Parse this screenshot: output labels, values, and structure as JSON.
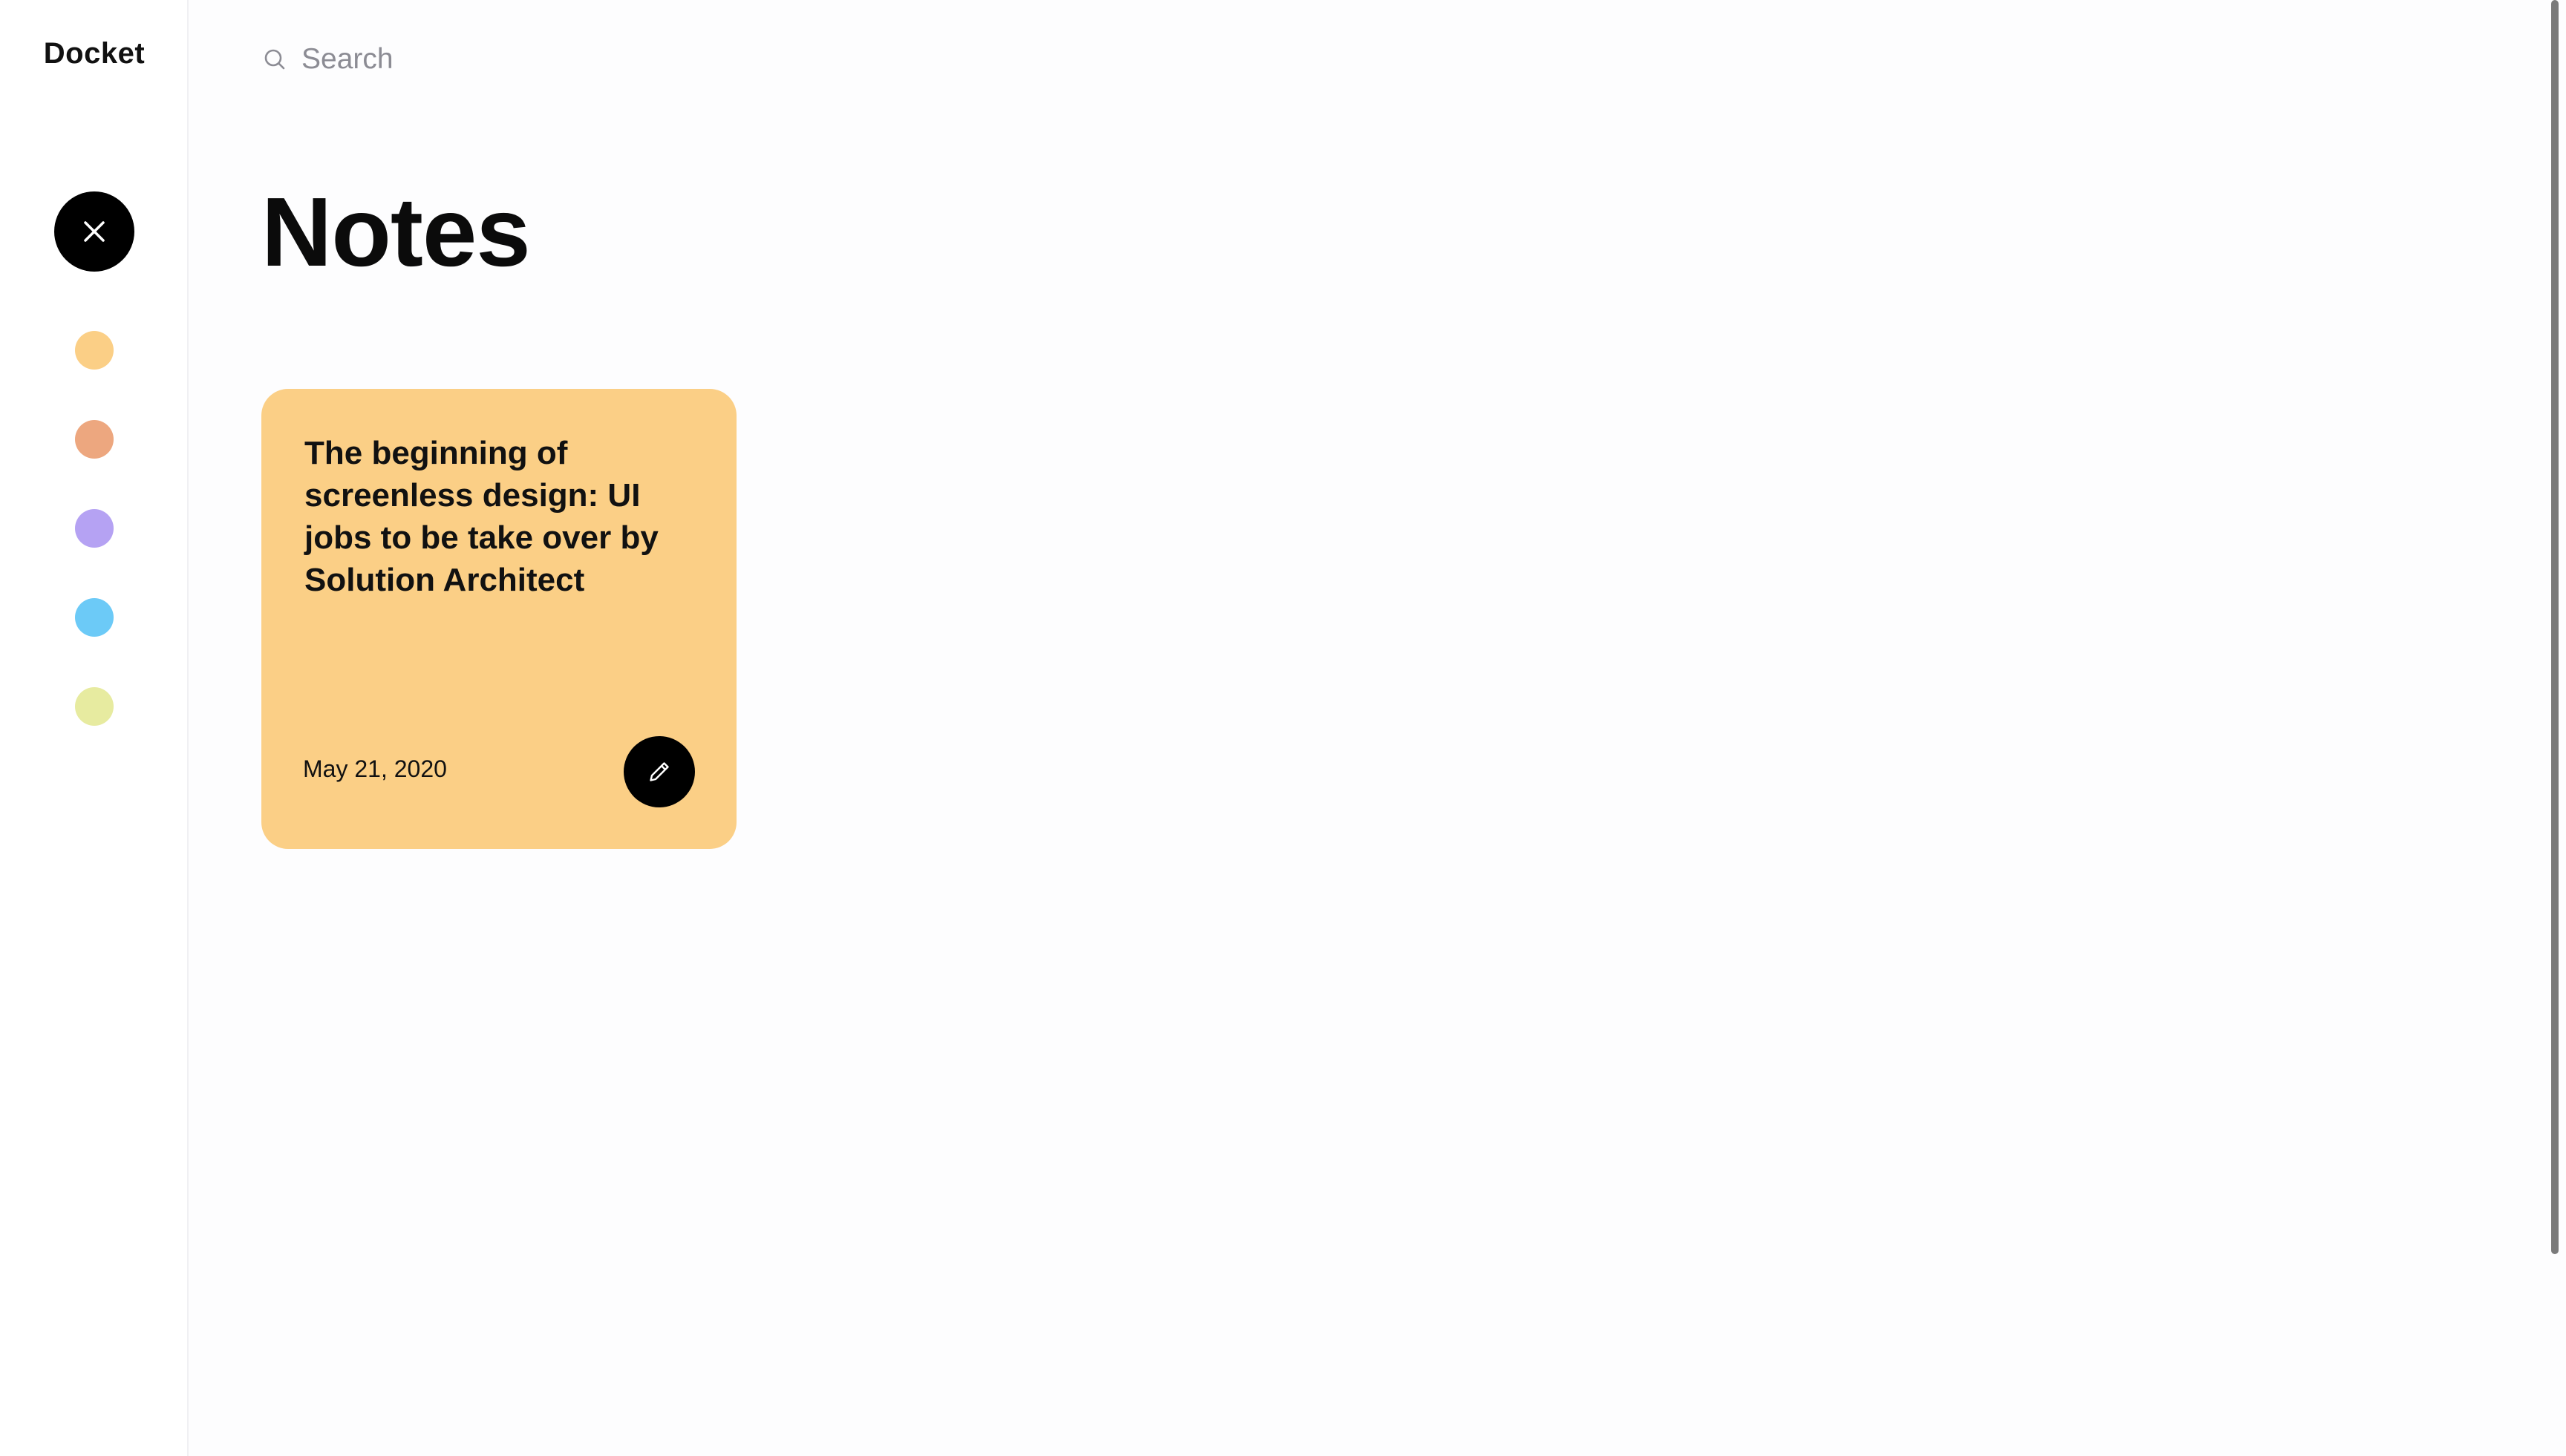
{
  "app": {
    "name": "Docket"
  },
  "sidebar": {
    "close_icon": "close-icon",
    "color_swatches": [
      {
        "name": "yellow",
        "color": "#fbcf86"
      },
      {
        "name": "orange",
        "color": "#eda77f"
      },
      {
        "name": "purple",
        "color": "#b5a2f3"
      },
      {
        "name": "blue",
        "color": "#6ccaf7"
      },
      {
        "name": "lime",
        "color": "#e7eba0"
      }
    ]
  },
  "search": {
    "icon": "search-icon",
    "placeholder": "Search",
    "value": ""
  },
  "main": {
    "title": "Notes",
    "notes": [
      {
        "text": "The beginning of screenless design: UI jobs to be take over by Solution Architect",
        "date": "May 21, 2020",
        "color": "#fbcf86",
        "edit_icon": "pencil-icon"
      }
    ]
  }
}
